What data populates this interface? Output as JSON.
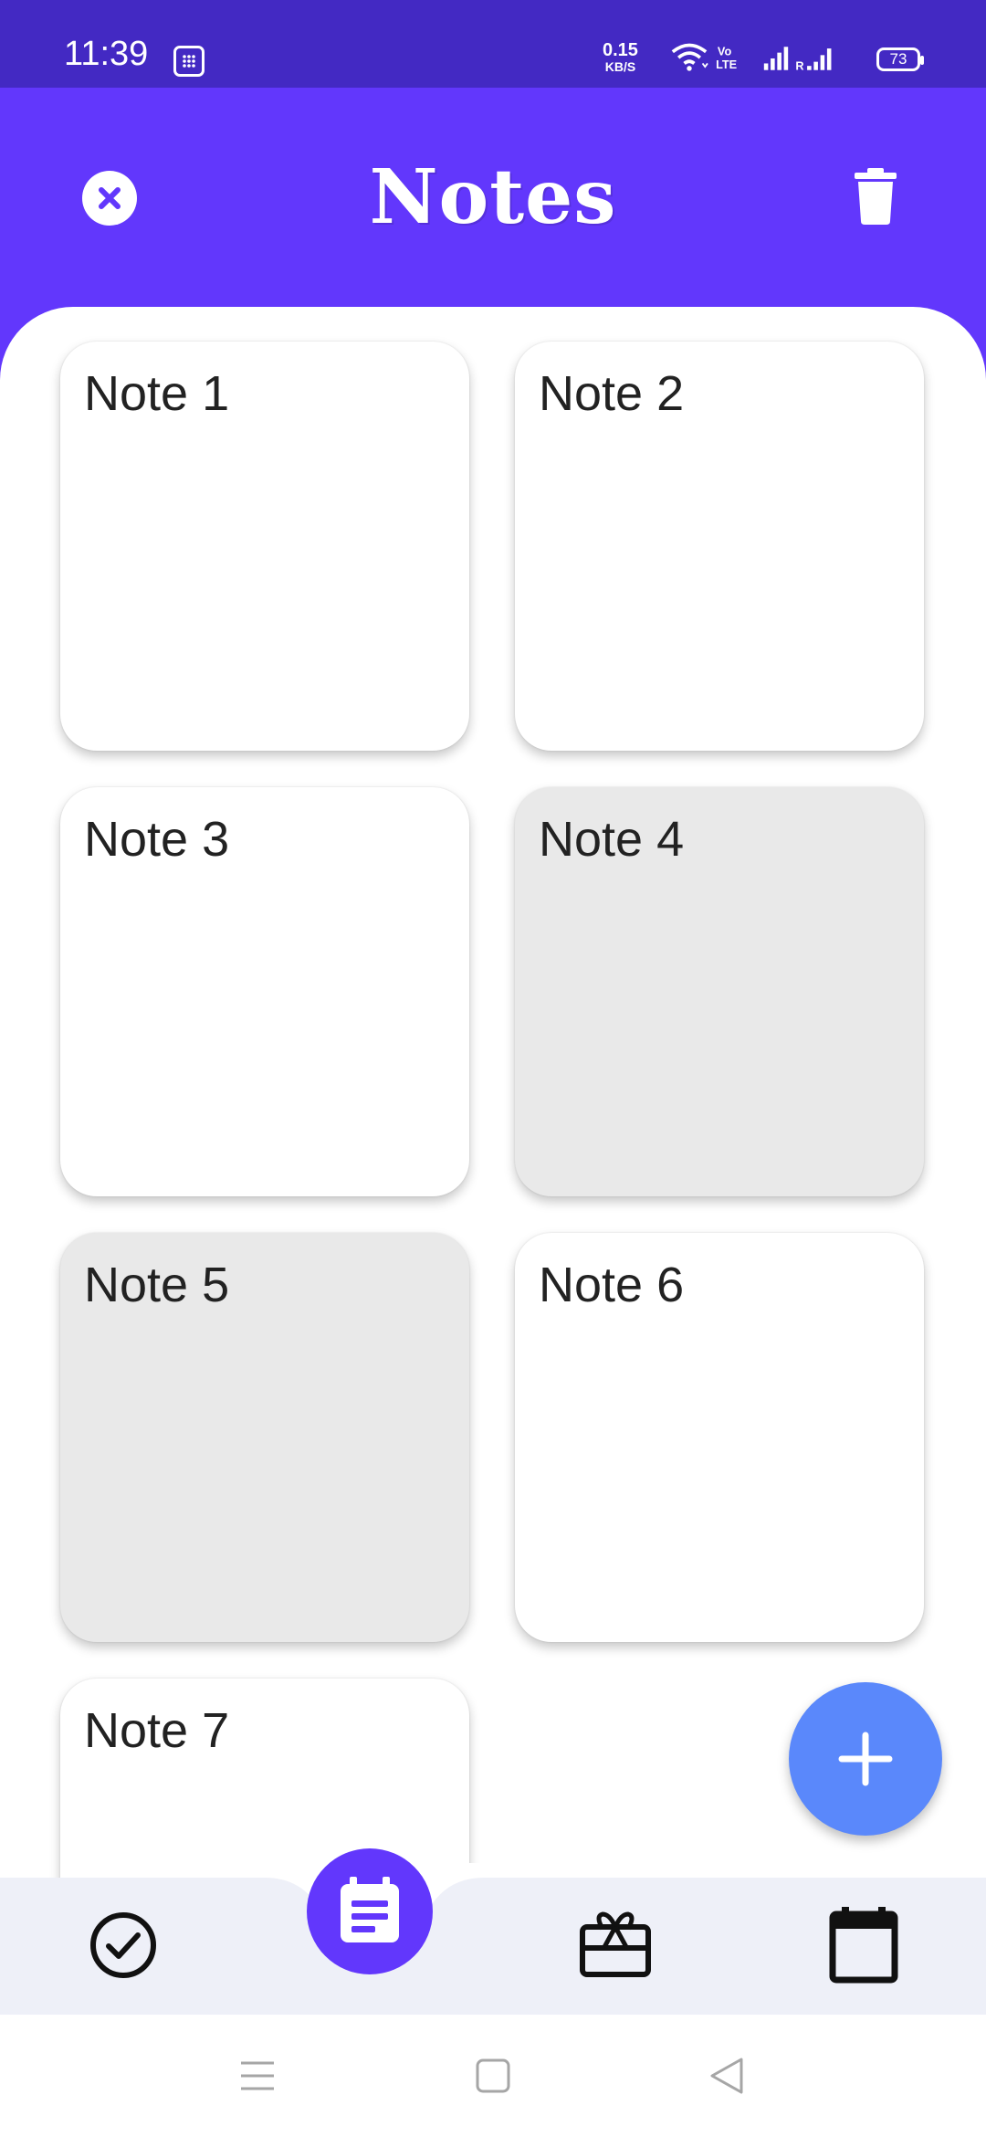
{
  "status_bar": {
    "time": "11:39",
    "net_speed_value": "0.15",
    "net_speed_unit": "KB/S",
    "volte_label": "Vo LTE",
    "roaming_label": "R",
    "battery_level": "73",
    "icons": [
      "calculator-icon",
      "wifi-icon",
      "volte-icon",
      "signal-icon",
      "signal-roaming-icon",
      "battery-icon"
    ]
  },
  "app_bar": {
    "title": "Notes",
    "left_icon": "close-circle-icon",
    "right_icon": "trash-icon"
  },
  "notes": [
    {
      "title": "Note 1",
      "selected": false
    },
    {
      "title": "Note 2",
      "selected": false
    },
    {
      "title": "Note 3",
      "selected": false
    },
    {
      "title": "Note 4",
      "selected": true
    },
    {
      "title": "Note 5",
      "selected": true
    },
    {
      "title": "Note 6",
      "selected": false
    },
    {
      "title": "Note 7",
      "selected": false
    }
  ],
  "fab": {
    "icon": "plus-icon"
  },
  "bottom_nav": {
    "items": [
      {
        "icon": "check-circle-icon"
      },
      {
        "icon": "notes-icon",
        "active": true
      },
      {
        "icon": "gift-card-icon"
      },
      {
        "icon": "calendar-icon"
      }
    ]
  },
  "system_nav": {
    "icons": [
      "menu-icon",
      "home-square-icon",
      "back-triangle-icon"
    ]
  },
  "colors": {
    "status_bar": "#4329c3",
    "app_bar": "#6237fc",
    "fab": "#5a88fb",
    "selected_card": "#e9e9e9",
    "bottom_nav": "#eef0f8"
  }
}
